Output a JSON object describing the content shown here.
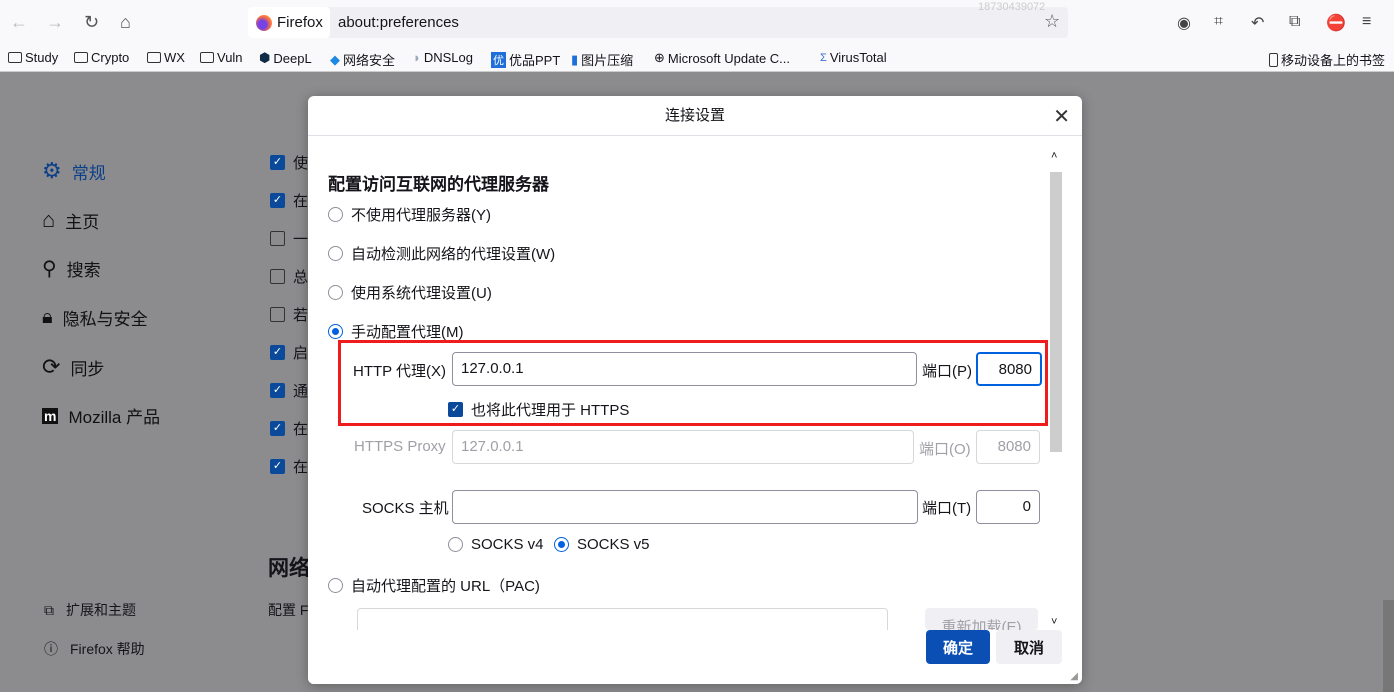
{
  "browser": {
    "identity_label": "Firefox",
    "url": "about:preferences",
    "watermark": "18730439072",
    "bookmarks": [
      {
        "label": "Study",
        "icon": "folder-icon"
      },
      {
        "label": "Crypto",
        "icon": "folder-icon"
      },
      {
        "label": "WX",
        "icon": "folder-icon"
      },
      {
        "label": "Vuln",
        "icon": "folder-icon"
      },
      {
        "label": "DeepL",
        "icon": "deepl-icon"
      },
      {
        "label": "网络安全",
        "icon": "diamond-icon"
      },
      {
        "label": "DNSLog",
        "icon": "dnslog-icon"
      },
      {
        "label": "优品PPT",
        "icon": "youpin-icon"
      },
      {
        "label": "图片压缩",
        "icon": "image-icon"
      },
      {
        "label": "Microsoft Update C...",
        "icon": "globe-icon"
      },
      {
        "label": "VirusTotal",
        "icon": "virustotal-icon"
      }
    ],
    "mobile_bookmarks": "移动设备上的书签"
  },
  "sidebar": {
    "items": [
      {
        "label": "常规",
        "icon": "gear-icon",
        "active": true
      },
      {
        "label": "主页",
        "icon": "home-icon"
      },
      {
        "label": "搜索",
        "icon": "search-icon"
      },
      {
        "label": "隐私与安全",
        "icon": "lock-icon"
      },
      {
        "label": "同步",
        "icon": "sync-icon"
      },
      {
        "label": "Mozilla 产品",
        "icon": "mozilla-icon"
      }
    ],
    "footer": [
      {
        "label": "扩展和主题",
        "icon": "puzzle-icon"
      },
      {
        "label": "Firefox 帮助",
        "icon": "help-icon"
      }
    ]
  },
  "content": {
    "checkboxes": [
      {
        "label": "使",
        "checked": true
      },
      {
        "label": "在",
        "checked": true
      },
      {
        "label": "一",
        "checked": false
      },
      {
        "label": "总",
        "checked": false
      },
      {
        "label": "若",
        "checked": false
      },
      {
        "label": "启",
        "checked": true
      },
      {
        "label": "通",
        "checked": true
      },
      {
        "label": "在",
        "checked": true
      },
      {
        "label": "在",
        "checked": true
      }
    ],
    "network_heading": "网络",
    "network_text": "配置 F"
  },
  "dialog": {
    "title": "连接设置",
    "heading": "配置访问互联网的代理服务器",
    "options": {
      "none": "不使用代理服务器(Y)",
      "auto_detect": "自动检测此网络的代理设置(W)",
      "system": "使用系统代理设置(U)",
      "manual": "手动配置代理(M)",
      "pac": "自动代理配置的 URL（PAC)"
    },
    "selected": "manual",
    "http_label": "HTTP 代理(X)",
    "http_value": "127.0.0.1",
    "http_port_label": "端口(P)",
    "http_port": "8080",
    "also_https": "也将此代理用于 HTTPS",
    "also_https_checked": true,
    "https_label": "HTTPS Proxy",
    "https_value": "127.0.0.1",
    "https_port_label": "端口(O)",
    "https_port": "8080",
    "socks_label": "SOCKS 主机",
    "socks_value": "",
    "socks_port_label": "端口(T)",
    "socks_port": "0",
    "socks_v4": "SOCKS v4",
    "socks_v5": "SOCKS v5",
    "socks_version": "v5",
    "pac_value": "",
    "reload_label": "重新加载(E)",
    "ok_label": "确定",
    "cancel_label": "取消",
    "highlight_color": "#ee1c1c",
    "accent": "#0061e0"
  }
}
